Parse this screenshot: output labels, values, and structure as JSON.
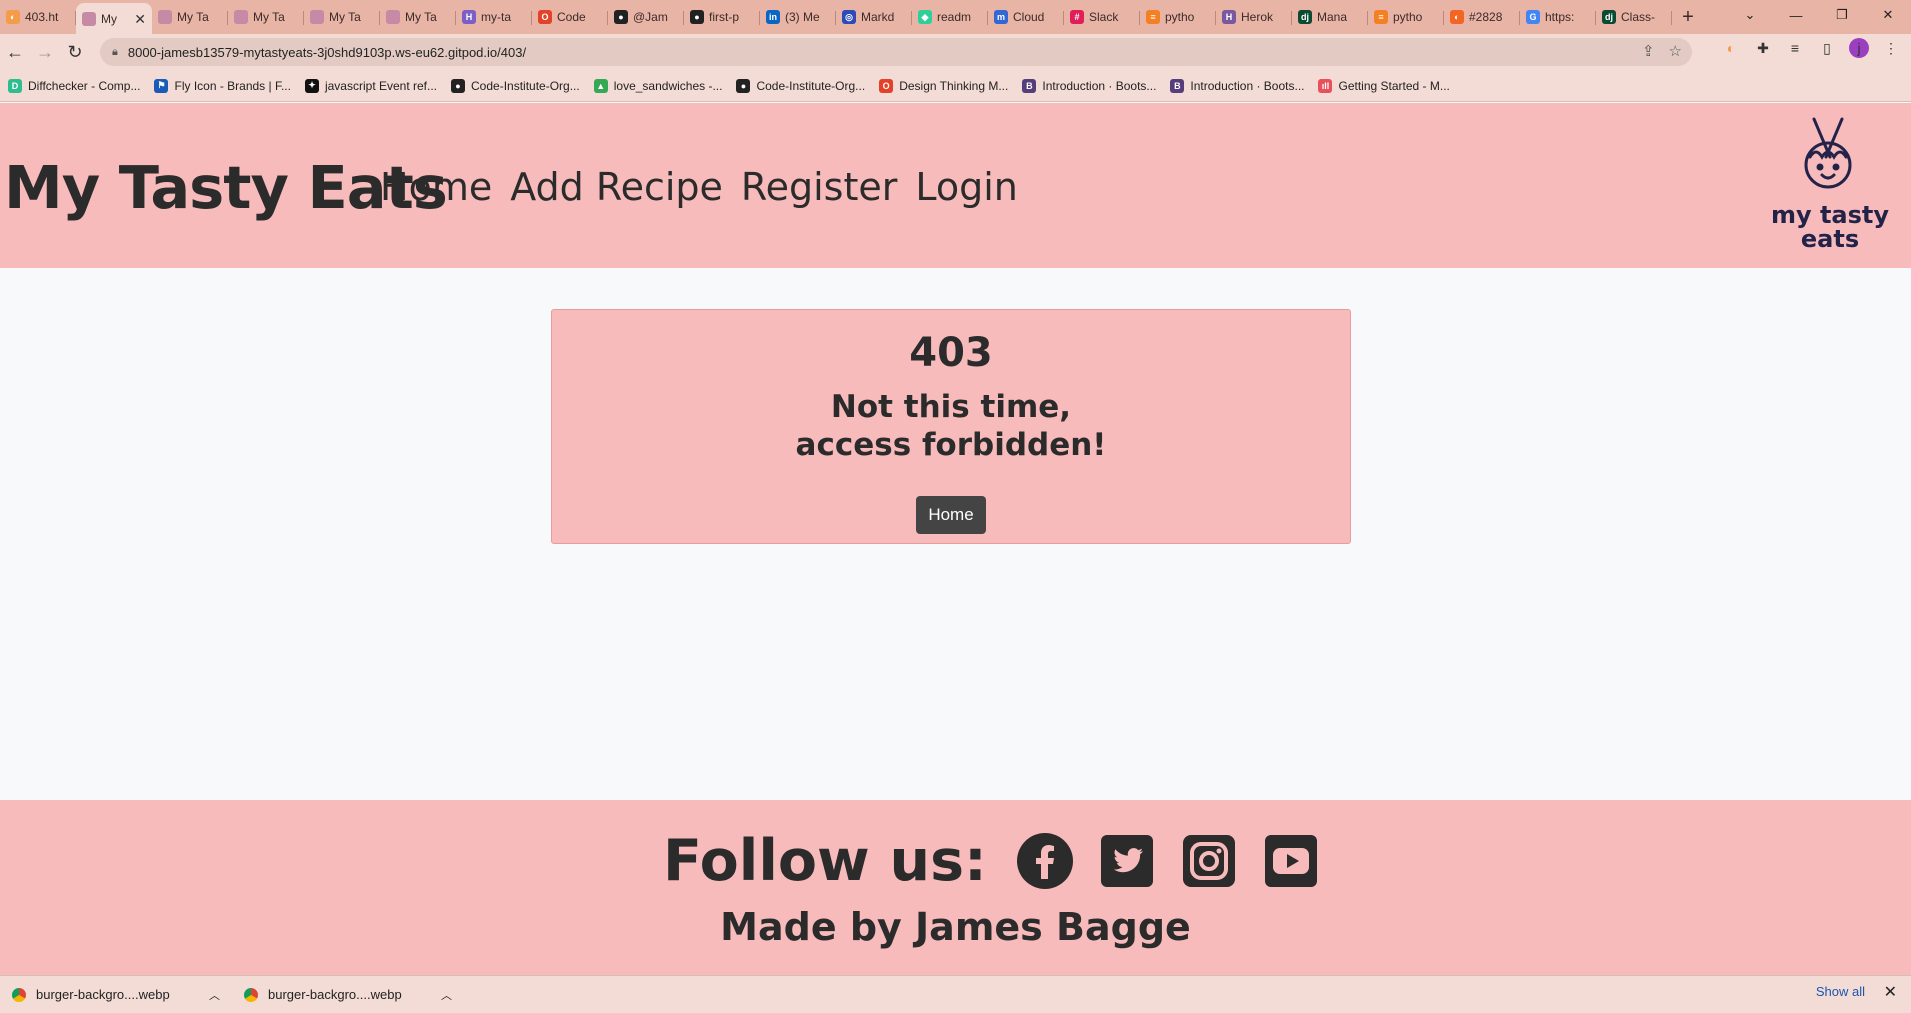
{
  "browser": {
    "tabs": [
      {
        "label": "403.ht",
        "color": "#f49c4a",
        "glyph": "◐"
      },
      {
        "label": "My",
        "color": "#c68aa6",
        "glyph": "",
        "active": true
      },
      {
        "label": "My Ta",
        "color": "#c68aa6",
        "glyph": ""
      },
      {
        "label": "My Ta",
        "color": "#c68aa6",
        "glyph": ""
      },
      {
        "label": "My Ta",
        "color": "#c68aa6",
        "glyph": ""
      },
      {
        "label": "My Ta",
        "color": "#c68aa6",
        "glyph": ""
      },
      {
        "label": "my-ta",
        "color": "#7b5fc5",
        "glyph": "H"
      },
      {
        "label": "Code",
        "color": "#e2412a",
        "glyph": "O"
      },
      {
        "label": "@Jam",
        "color": "#222222",
        "glyph": "●"
      },
      {
        "label": "first-p",
        "color": "#222222",
        "glyph": "●"
      },
      {
        "label": "(3) Me",
        "color": "#0a66c2",
        "glyph": "in"
      },
      {
        "label": "Markd",
        "color": "#2b4bb8",
        "glyph": "◎"
      },
      {
        "label": "readm",
        "color": "#2fcf9a",
        "glyph": "◆"
      },
      {
        "label": "Cloud",
        "color": "#3467d6",
        "glyph": "m"
      },
      {
        "label": "Slack",
        "color": "#e01e5a",
        "glyph": "#"
      },
      {
        "label": "pytho",
        "color": "#f48024",
        "glyph": "≡"
      },
      {
        "label": "Herok",
        "color": "#79589f",
        "glyph": "H"
      },
      {
        "label": "Mana",
        "color": "#0c4b33",
        "glyph": "dj"
      },
      {
        "label": "pytho",
        "color": "#f48024",
        "glyph": "≡"
      },
      {
        "label": "#2828",
        "color": "#f26522",
        "glyph": "◐"
      },
      {
        "label": "https:",
        "color": "#4285f4",
        "glyph": "G"
      },
      {
        "label": "Class-",
        "color": "#0c4b33",
        "glyph": "dj"
      }
    ],
    "tab_close": "✕",
    "new_tab": "+",
    "window_controls": {
      "dropdown": "⌄",
      "minimize": "—",
      "restore": "❐",
      "close": "✕"
    },
    "url": "8000-jamesb13579-mytastyeats-3j0shd9103p.ws-eu62.gitpod.io/403/",
    "profile_initial": "j",
    "bookmarks": [
      {
        "label": "Diffchecker - Comp...",
        "color": "#2dbd8e",
        "glyph": "D"
      },
      {
        "label": "Fly Icon - Brands | F...",
        "color": "#1a5bb8",
        "glyph": "⚑"
      },
      {
        "label": "javascript Event ref...",
        "color": "#111111",
        "glyph": "✦"
      },
      {
        "label": "Code-Institute-Org...",
        "color": "#222222",
        "glyph": "●"
      },
      {
        "label": "love_sandwiches -...",
        "color": "#34a853",
        "glyph": "▲"
      },
      {
        "label": "Code-Institute-Org...",
        "color": "#222222",
        "glyph": "●"
      },
      {
        "label": "Design Thinking M...",
        "color": "#e2412a",
        "glyph": "O"
      },
      {
        "label": "Introduction · Boots...",
        "color": "#563d7c",
        "glyph": "B"
      },
      {
        "label": "Introduction · Boots...",
        "color": "#563d7c",
        "glyph": "B"
      },
      {
        "label": "Getting Started - M...",
        "color": "#e8505b",
        "glyph": "ıll"
      }
    ]
  },
  "site": {
    "brand": "My Tasty Eats",
    "nav": [
      "Home",
      "Add Recipe",
      "Register",
      "Login"
    ],
    "logo_text_line1": "my tasty",
    "logo_text_line2": "eats"
  },
  "error": {
    "code": "403",
    "message": "Not this time, access forbidden!",
    "button": "Home"
  },
  "footer": {
    "follow": "Follow us:",
    "social": [
      "facebook-icon",
      "twitter-icon",
      "instagram-icon",
      "youtube-icon"
    ],
    "made_by": "Made by James Bagge"
  },
  "downloads": {
    "items": [
      "burger-backgro....webp",
      "burger-backgro....webp"
    ],
    "show_all": "Show all",
    "close": "✕"
  },
  "colors": {
    "header_bg": "#f8bbbb",
    "page_bg": "#f8f9fa",
    "button_bg": "#444444",
    "text": "#2b2b2b"
  }
}
